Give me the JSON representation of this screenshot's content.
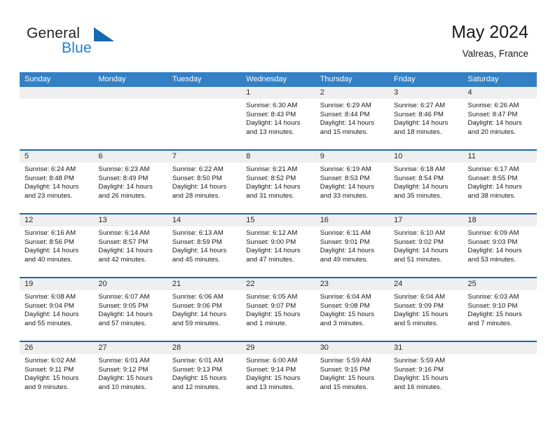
{
  "brand": {
    "word_one": "General",
    "word_two": "Blue",
    "triangle_icon": "triangle-icon"
  },
  "header": {
    "title": "May 2024",
    "location": "Valreas, France"
  },
  "colors": {
    "header_blue": "#3480c4",
    "rule_blue": "#1668b3",
    "day_band_gray": "#efefef",
    "brand_blue": "#1f7fd0",
    "text": "#1a1a1a"
  },
  "weekdays": [
    "Sunday",
    "Monday",
    "Tuesday",
    "Wednesday",
    "Thursday",
    "Friday",
    "Saturday"
  ],
  "weeks": [
    [
      {
        "day": "",
        "empty": true
      },
      {
        "day": "",
        "empty": true
      },
      {
        "day": "",
        "empty": true
      },
      {
        "day": "1",
        "sunrise": "Sunrise: 6:30 AM",
        "sunset": "Sunset: 8:43 PM",
        "daylight": "Daylight: 14 hours and 13 minutes."
      },
      {
        "day": "2",
        "sunrise": "Sunrise: 6:29 AM",
        "sunset": "Sunset: 8:44 PM",
        "daylight": "Daylight: 14 hours and 15 minutes."
      },
      {
        "day": "3",
        "sunrise": "Sunrise: 6:27 AM",
        "sunset": "Sunset: 8:46 PM",
        "daylight": "Daylight: 14 hours and 18 minutes."
      },
      {
        "day": "4",
        "sunrise": "Sunrise: 6:26 AM",
        "sunset": "Sunset: 8:47 PM",
        "daylight": "Daylight: 14 hours and 20 minutes."
      }
    ],
    [
      {
        "day": "5",
        "sunrise": "Sunrise: 6:24 AM",
        "sunset": "Sunset: 8:48 PM",
        "daylight": "Daylight: 14 hours and 23 minutes."
      },
      {
        "day": "6",
        "sunrise": "Sunrise: 6:23 AM",
        "sunset": "Sunset: 8:49 PM",
        "daylight": "Daylight: 14 hours and 26 minutes."
      },
      {
        "day": "7",
        "sunrise": "Sunrise: 6:22 AM",
        "sunset": "Sunset: 8:50 PM",
        "daylight": "Daylight: 14 hours and 28 minutes."
      },
      {
        "day": "8",
        "sunrise": "Sunrise: 6:21 AM",
        "sunset": "Sunset: 8:52 PM",
        "daylight": "Daylight: 14 hours and 31 minutes."
      },
      {
        "day": "9",
        "sunrise": "Sunrise: 6:19 AM",
        "sunset": "Sunset: 8:53 PM",
        "daylight": "Daylight: 14 hours and 33 minutes."
      },
      {
        "day": "10",
        "sunrise": "Sunrise: 6:18 AM",
        "sunset": "Sunset: 8:54 PM",
        "daylight": "Daylight: 14 hours and 35 minutes."
      },
      {
        "day": "11",
        "sunrise": "Sunrise: 6:17 AM",
        "sunset": "Sunset: 8:55 PM",
        "daylight": "Daylight: 14 hours and 38 minutes."
      }
    ],
    [
      {
        "day": "12",
        "sunrise": "Sunrise: 6:16 AM",
        "sunset": "Sunset: 8:56 PM",
        "daylight": "Daylight: 14 hours and 40 minutes."
      },
      {
        "day": "13",
        "sunrise": "Sunrise: 6:14 AM",
        "sunset": "Sunset: 8:57 PM",
        "daylight": "Daylight: 14 hours and 42 minutes."
      },
      {
        "day": "14",
        "sunrise": "Sunrise: 6:13 AM",
        "sunset": "Sunset: 8:59 PM",
        "daylight": "Daylight: 14 hours and 45 minutes."
      },
      {
        "day": "15",
        "sunrise": "Sunrise: 6:12 AM",
        "sunset": "Sunset: 9:00 PM",
        "daylight": "Daylight: 14 hours and 47 minutes."
      },
      {
        "day": "16",
        "sunrise": "Sunrise: 6:11 AM",
        "sunset": "Sunset: 9:01 PM",
        "daylight": "Daylight: 14 hours and 49 minutes."
      },
      {
        "day": "17",
        "sunrise": "Sunrise: 6:10 AM",
        "sunset": "Sunset: 9:02 PM",
        "daylight": "Daylight: 14 hours and 51 minutes."
      },
      {
        "day": "18",
        "sunrise": "Sunrise: 6:09 AM",
        "sunset": "Sunset: 9:03 PM",
        "daylight": "Daylight: 14 hours and 53 minutes."
      }
    ],
    [
      {
        "day": "19",
        "sunrise": "Sunrise: 6:08 AM",
        "sunset": "Sunset: 9:04 PM",
        "daylight": "Daylight: 14 hours and 55 minutes."
      },
      {
        "day": "20",
        "sunrise": "Sunrise: 6:07 AM",
        "sunset": "Sunset: 9:05 PM",
        "daylight": "Daylight: 14 hours and 57 minutes."
      },
      {
        "day": "21",
        "sunrise": "Sunrise: 6:06 AM",
        "sunset": "Sunset: 9:06 PM",
        "daylight": "Daylight: 14 hours and 59 minutes."
      },
      {
        "day": "22",
        "sunrise": "Sunrise: 6:05 AM",
        "sunset": "Sunset: 9:07 PM",
        "daylight": "Daylight: 15 hours and 1 minute."
      },
      {
        "day": "23",
        "sunrise": "Sunrise: 6:04 AM",
        "sunset": "Sunset: 9:08 PM",
        "daylight": "Daylight: 15 hours and 3 minutes."
      },
      {
        "day": "24",
        "sunrise": "Sunrise: 6:04 AM",
        "sunset": "Sunset: 9:09 PM",
        "daylight": "Daylight: 15 hours and 5 minutes."
      },
      {
        "day": "25",
        "sunrise": "Sunrise: 6:03 AM",
        "sunset": "Sunset: 9:10 PM",
        "daylight": "Daylight: 15 hours and 7 minutes."
      }
    ],
    [
      {
        "day": "26",
        "sunrise": "Sunrise: 6:02 AM",
        "sunset": "Sunset: 9:11 PM",
        "daylight": "Daylight: 15 hours and 9 minutes."
      },
      {
        "day": "27",
        "sunrise": "Sunrise: 6:01 AM",
        "sunset": "Sunset: 9:12 PM",
        "daylight": "Daylight: 15 hours and 10 minutes."
      },
      {
        "day": "28",
        "sunrise": "Sunrise: 6:01 AM",
        "sunset": "Sunset: 9:13 PM",
        "daylight": "Daylight: 15 hours and 12 minutes."
      },
      {
        "day": "29",
        "sunrise": "Sunrise: 6:00 AM",
        "sunset": "Sunset: 9:14 PM",
        "daylight": "Daylight: 15 hours and 13 minutes."
      },
      {
        "day": "30",
        "sunrise": "Sunrise: 5:59 AM",
        "sunset": "Sunset: 9:15 PM",
        "daylight": "Daylight: 15 hours and 15 minutes."
      },
      {
        "day": "31",
        "sunrise": "Sunrise: 5:59 AM",
        "sunset": "Sunset: 9:16 PM",
        "daylight": "Daylight: 15 hours and 16 minutes."
      },
      {
        "day": "",
        "empty": true
      }
    ]
  ]
}
